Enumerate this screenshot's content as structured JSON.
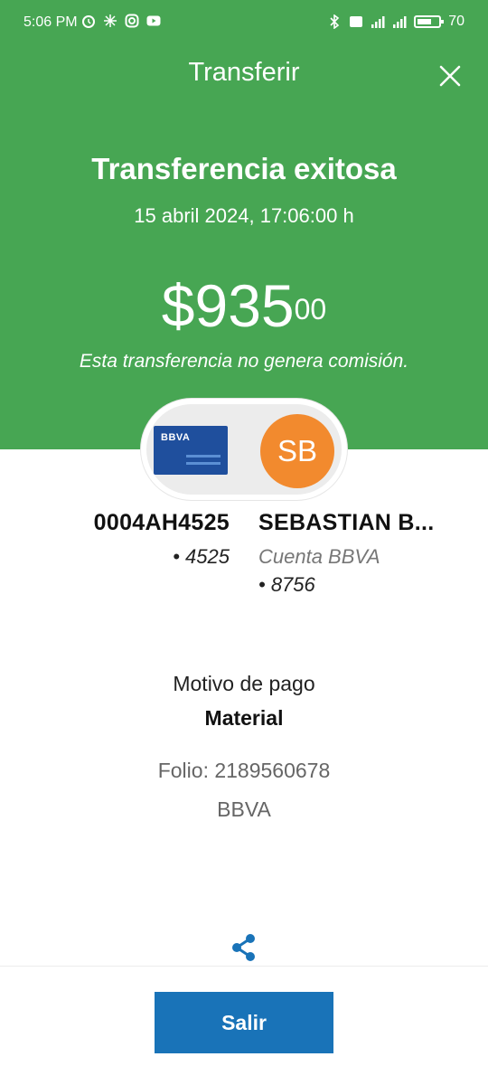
{
  "status_bar": {
    "time": "5:06 PM",
    "battery": "70",
    "icons": [
      "alarm-icon",
      "pinwheel-icon",
      "instagram-icon",
      "youtube-icon",
      "bluetooth-icon",
      "volte-icon",
      "signal-icon",
      "signal-icon",
      "battery-icon"
    ]
  },
  "header": {
    "title": "Transferir",
    "close_icon": "close-icon"
  },
  "receipt": {
    "title": "Transferencia exitosa",
    "date": "15 abril 2024, 17:06:00 h",
    "amount_main": "$935",
    "amount_cents": "00",
    "commission_note": "Esta transferencia no genera comisión."
  },
  "source": {
    "card_brand": "BBVA",
    "account": "0004AH4525",
    "last_digits": "• 4525"
  },
  "destination": {
    "initials": "SB",
    "name": "SEBASTIAN B...",
    "account_type": "Cuenta BBVA",
    "last_digits": "• 8756"
  },
  "details": {
    "motivo_label": "Motivo de pago",
    "motivo_value": "Material",
    "folio": "Folio: 2189560678",
    "bank": "BBVA"
  },
  "actions": {
    "share_icon": "share-icon",
    "exit_label": "Salir"
  },
  "colors": {
    "header_green": "#47a653",
    "button_blue": "#1973b8",
    "avatar_orange": "#f28a2e",
    "card_blue": "#1f4f9d"
  }
}
